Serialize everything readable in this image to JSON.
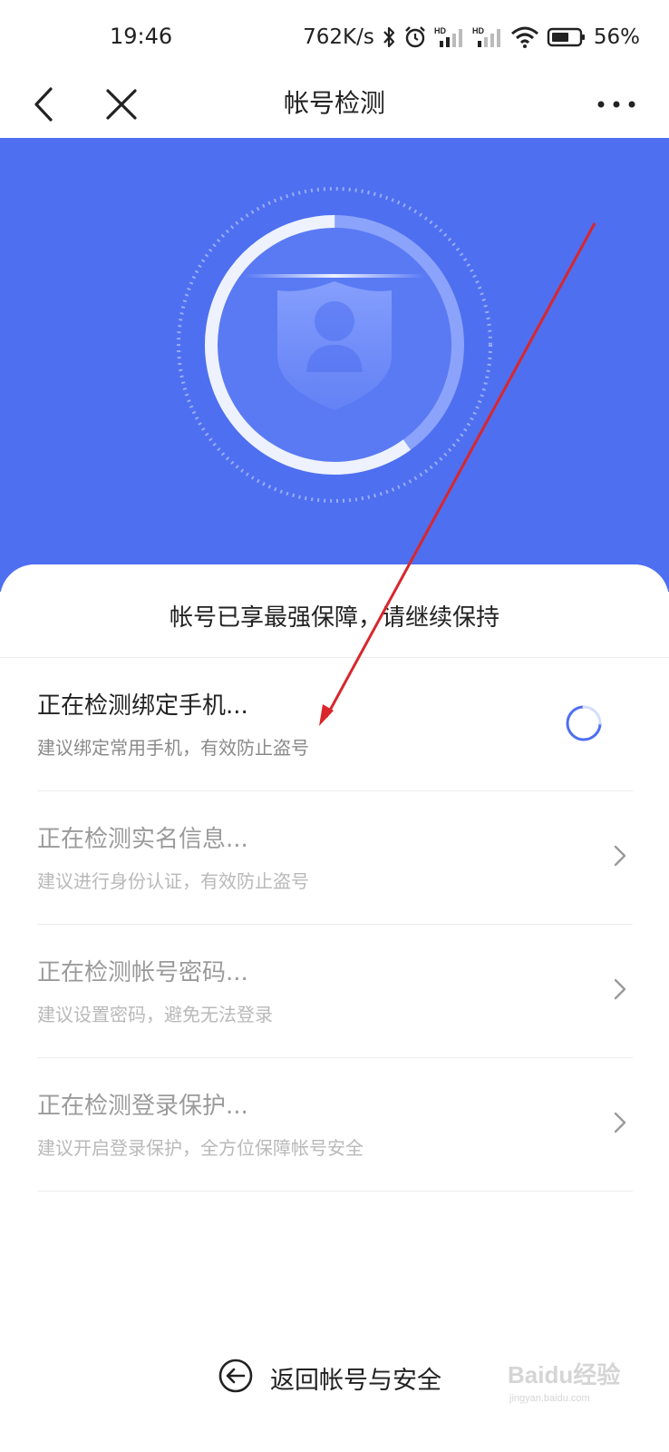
{
  "status_bar": {
    "time": "19:46",
    "net_speed": "762K/s",
    "battery": "56%",
    "icons": [
      "bluetooth-icon",
      "alarm-icon",
      "hd-signal-icon",
      "hd-signal-icon",
      "wifi-icon",
      "battery-icon"
    ]
  },
  "nav": {
    "title": "帐号检测",
    "icons": [
      "back-icon",
      "close-icon",
      "more-icon"
    ]
  },
  "hero": {
    "progress": 0.6,
    "icon": "shield-user-icon",
    "background": "#4e6ff0"
  },
  "result": {
    "message": "帐号已享最强保障，请继续保持"
  },
  "checks": [
    {
      "title": "正在检测绑定手机...",
      "desc": "建议绑定常用手机，有效防止盗号",
      "state": "loading"
    },
    {
      "title": "正在检测实名信息...",
      "desc": "建议进行身份认证，有效防止盗号",
      "state": "pending"
    },
    {
      "title": "正在检测帐号密码...",
      "desc": "建议设置密码，避免无法登录",
      "state": "pending"
    },
    {
      "title": "正在检测登录保护...",
      "desc": "建议开启登录保护，全方位保障帐号安全",
      "state": "pending"
    }
  ],
  "footer": {
    "back_label": "返回帐号与安全",
    "icon": "back-circle-icon"
  },
  "watermark": {
    "text": "Baidu经验",
    "sub": "jingyan.baidu.com"
  },
  "colors": {
    "accent": "#4e6ff0",
    "annotation": "#d9262b"
  }
}
